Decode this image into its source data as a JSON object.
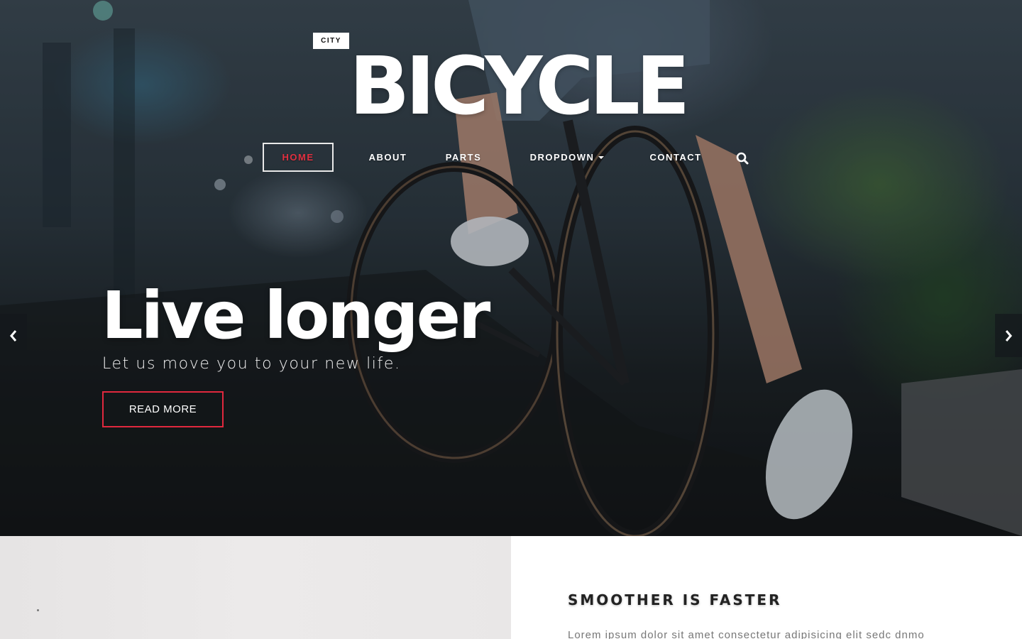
{
  "brand": {
    "tag": "CITY",
    "title": "BICYCLE"
  },
  "nav": {
    "items": [
      {
        "label": "HOME",
        "active": true
      },
      {
        "label": "ABOUT",
        "active": false
      },
      {
        "label": "PARTS",
        "active": false
      },
      {
        "label": "DROPDOWN",
        "active": false,
        "has_caret": true
      },
      {
        "label": "CONTACT",
        "active": false
      }
    ],
    "search_icon": "search-icon"
  },
  "hero": {
    "heading": "Live longer",
    "subheading": "Let us move you to your new life.",
    "button_label": "READ MORE",
    "prev_icon": "chevron-left-icon",
    "next_icon": "chevron-right-icon"
  },
  "section": {
    "title": "SMOOTHER IS FASTER",
    "text": "Lorem ipsum dolor sit amet consectetur adipisicing elit sedc dnmo"
  },
  "colors": {
    "accent": "#e0283e",
    "active_nav_text": "#e03040",
    "white": "#ffffff"
  }
}
